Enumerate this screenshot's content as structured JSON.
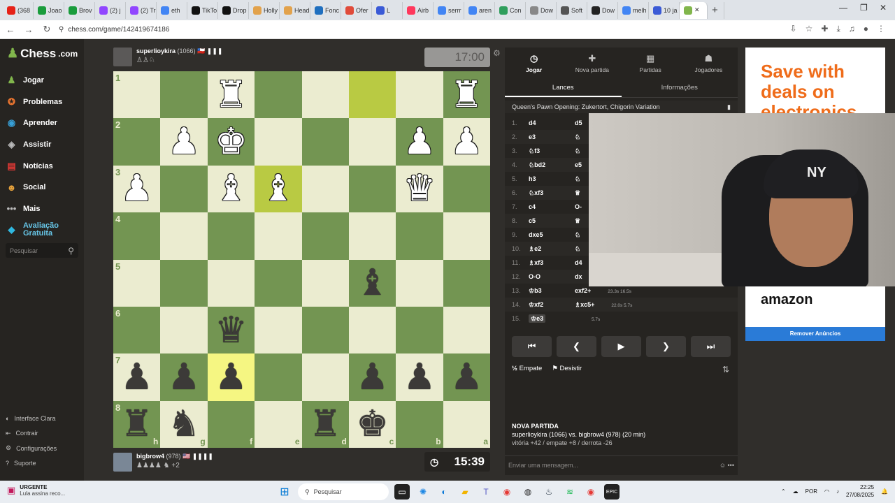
{
  "browser": {
    "tabs": [
      {
        "label": "(368",
        "color": "#e62117"
      },
      {
        "label": "Joao",
        "color": "#1a9c3c"
      },
      {
        "label": "Brov",
        "color": "#1a9c3c"
      },
      {
        "label": "(2) j",
        "color": "#9146ff"
      },
      {
        "label": "(2) Tr",
        "color": "#9146ff"
      },
      {
        "label": "eth",
        "color": "#4285f4"
      },
      {
        "label": "TikTo",
        "color": "#111111"
      },
      {
        "label": "Drop",
        "color": "#111111"
      },
      {
        "label": "Holly",
        "color": "#e2a24c"
      },
      {
        "label": "Head",
        "color": "#e2a24c"
      },
      {
        "label": "Fonc",
        "color": "#1f6fbf"
      },
      {
        "label": "Ofer",
        "color": "#e04b3a"
      },
      {
        "label": "L",
        "color": "#3a5ad6"
      },
      {
        "label": "Airb",
        "color": "#ff385c"
      },
      {
        "label": "serrr",
        "color": "#4285f4"
      },
      {
        "label": "aren",
        "color": "#4285f4"
      },
      {
        "label": "Con",
        "color": "#2f9e5c"
      },
      {
        "label": "Dow",
        "color": "#888888"
      },
      {
        "label": "Soft",
        "color": "#555555"
      },
      {
        "label": "Dow",
        "color": "#222222"
      },
      {
        "label": "melh",
        "color": "#4285f4"
      },
      {
        "label": "10 ja",
        "color": "#3a5ad6"
      }
    ],
    "new_tab": "+",
    "url": "chess.com/game/142419674186"
  },
  "sidebar": {
    "brand": "Chess",
    "brand_suffix": ".com",
    "items": [
      {
        "label": "Jogar",
        "icon": "♟"
      },
      {
        "label": "Problemas",
        "icon": "✪"
      },
      {
        "label": "Aprender",
        "icon": "◉"
      },
      {
        "label": "Assistir",
        "icon": "◈"
      },
      {
        "label": "Notícias",
        "icon": "▤"
      },
      {
        "label": "Social",
        "icon": "☻"
      },
      {
        "label": "Mais",
        "icon": "•••"
      },
      {
        "label": "Avaliação Gratuita",
        "icon": "◆"
      }
    ],
    "search_placeholder": "Pesquisar",
    "bottom": [
      {
        "label": "Interface Clara",
        "icon": "◐"
      },
      {
        "label": "Contrair",
        "icon": "⇤"
      },
      {
        "label": "Configurações",
        "icon": "⚙"
      },
      {
        "label": "Suporte",
        "icon": "?"
      }
    ]
  },
  "top_player": {
    "name": "superlioykira",
    "rating": "(1066)",
    "flags": "🇨🇱 ❚❚❚",
    "captured": "♙♙♘",
    "clock": "17:00"
  },
  "bottom_player": {
    "name": "bigbrow4",
    "rating": "(978)",
    "flags": "🇺🇸 ❚❚❚❚",
    "captured": "♟♟♟♟ ♞",
    "advantage": "+2",
    "clock": "15:39"
  },
  "board": {
    "rows": [
      [
        "",
        "",
        "R",
        "",
        "",
        "",
        "",
        "R"
      ],
      [
        "",
        "P",
        "K",
        "",
        "",
        "",
        "P",
        "P"
      ],
      [
        "P",
        "",
        "B",
        "B",
        "",
        "",
        "Q",
        ""
      ],
      [
        "",
        "",
        "",
        "",
        "",
        "",
        "",
        ""
      ],
      [
        "",
        "",
        "",
        "",
        "",
        "b",
        "",
        ""
      ],
      [
        "",
        "",
        "q",
        "",
        "",
        "",
        "",
        ""
      ],
      [
        "p",
        "p",
        "p",
        "",
        "",
        "p",
        "p",
        "p"
      ],
      [
        "r",
        "n",
        "",
        "",
        "r",
        "k",
        "",
        ""
      ]
    ],
    "ranks": [
      "1",
      "2",
      "3",
      "4",
      "5",
      "6",
      "7",
      "8"
    ],
    "files": [
      "h",
      "g",
      "f",
      "e",
      "d",
      "c",
      "b",
      "a"
    ],
    "highlights": [
      {
        "r": 0,
        "c": 5,
        "k": "hd"
      },
      {
        "r": 2,
        "c": 3,
        "k": "hd"
      },
      {
        "r": 6,
        "c": 2,
        "k": "hl"
      }
    ]
  },
  "panel": {
    "tabs": [
      {
        "label": "Jogar",
        "icon": "◷"
      },
      {
        "label": "Nova partida",
        "icon": "✚"
      },
      {
        "label": "Partidas",
        "icon": "▦"
      },
      {
        "label": "Jogadores",
        "icon": "☗"
      }
    ],
    "subtabs": [
      "Lances",
      "Informações"
    ],
    "opening": "Queen's Pawn Opening: Zukertort, Chigorin Variation",
    "moves": [
      {
        "n": "1.",
        "w": "d4",
        "b": "d5",
        "t": ""
      },
      {
        "n": "2.",
        "w": "e3",
        "b": "♘",
        "t": ""
      },
      {
        "n": "3.",
        "w": "♘f3",
        "b": "♘",
        "t": ""
      },
      {
        "n": "4.",
        "w": "♘bd2",
        "b": "e5",
        "t": ""
      },
      {
        "n": "5.",
        "w": "h3",
        "b": "♘",
        "t": ""
      },
      {
        "n": "6.",
        "w": "♘xf3",
        "b": "♕",
        "t": ""
      },
      {
        "n": "7.",
        "w": "c4",
        "b": "O-",
        "t": ""
      },
      {
        "n": "8.",
        "w": "c5",
        "b": "♕",
        "t": ""
      },
      {
        "n": "9.",
        "w": "dxe5",
        "b": "♘",
        "t": ""
      },
      {
        "n": "10.",
        "w": "♗e2",
        "b": "♘",
        "t": ""
      },
      {
        "n": "11.",
        "w": "♗xf3",
        "b": "d4",
        "t": ""
      },
      {
        "n": "12.",
        "w": "O-O",
        "b": "dx",
        "t": ""
      },
      {
        "n": "13.",
        "w": "♔b3",
        "b": "exf2+",
        "t": "23.3s 16.5s"
      },
      {
        "n": "14.",
        "w": "♔xf2",
        "b": "♗xc5+",
        "t": "22.0s 5.7s"
      },
      {
        "n": "15.",
        "w": "♔e3",
        "b": "",
        "t": "5.7s"
      }
    ],
    "controls": [
      "⏮",
      "❮",
      "▶",
      "❯",
      "⏭"
    ],
    "draw": "Empate",
    "resign": "Desistir",
    "new_game_title": "NOVA PARTIDA",
    "new_game_line": "superlioykira (1066) vs. bigbrow4 (978) (20 min)",
    "new_game_stats": "vitória +42 / empate +8 / derrota -26",
    "chat_placeholder": "Enviar uma mensagem..."
  },
  "ad": {
    "title": "Save with deals on electronics",
    "brand": "amazon",
    "remove": "Remover Anúncios"
  },
  "taskbar": {
    "weather_title": "URGENTE",
    "weather_sub": "Lula assina reco...",
    "search": "Pesquisar",
    "lang": "POR",
    "time": "22:25",
    "date": "27/08/2025"
  }
}
